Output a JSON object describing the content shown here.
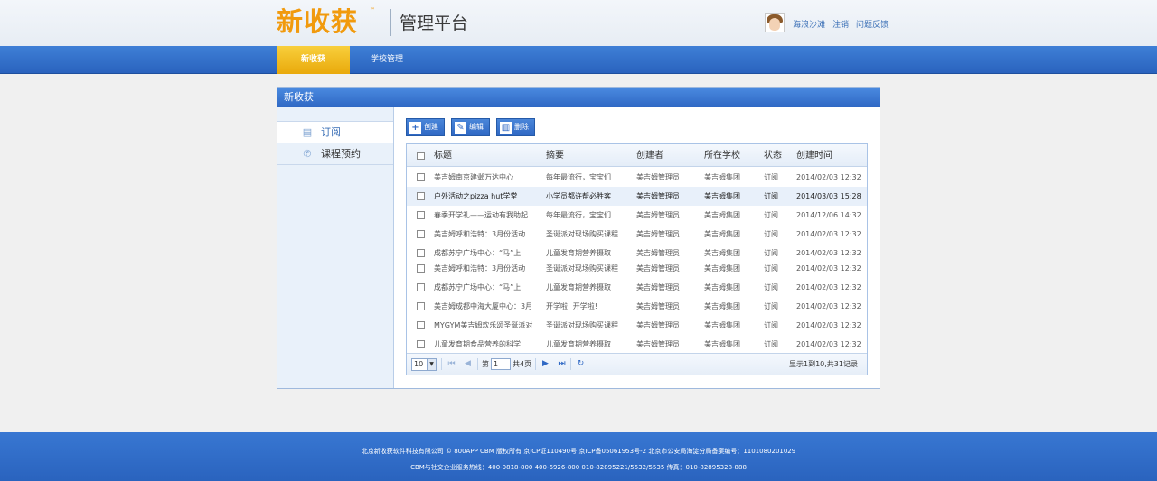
{
  "header": {
    "logo": "新收获",
    "logo_tm": "™",
    "platform_title": "管理平台",
    "user_links": [
      "海浪沙滩",
      "注销",
      "问题反馈"
    ]
  },
  "nav": {
    "items": [
      {
        "label": "新收获",
        "active": true
      },
      {
        "label": "学校管理",
        "active": false
      }
    ]
  },
  "panel": {
    "title": "新收获",
    "sidebar": [
      {
        "label": "订阅",
        "icon": "document-icon",
        "active": true
      },
      {
        "label": "课程预约",
        "icon": "phone-calendar-icon",
        "active": false
      }
    ],
    "toolbar": [
      {
        "label": "创建",
        "icon": "plus-icon"
      },
      {
        "label": "编辑",
        "icon": "edit-icon"
      },
      {
        "label": "删除",
        "icon": "trash-icon"
      }
    ]
  },
  "table": {
    "columns": [
      "标题",
      "摘要",
      "创建者",
      "所在学校",
      "状态",
      "创建时间"
    ],
    "rows": [
      {
        "title": "美吉姆南京建邺万达中心",
        "summary": "每年最流行，宝宝们",
        "creator": "美吉姆管理员",
        "school": "美吉姆集团",
        "status": "订阅",
        "time": "2014/02/03 12:32"
      },
      {
        "title": "户外活动之pizza hut学堂",
        "summary": "小学员都许帮必胜客",
        "creator": "美吉姆管理员",
        "school": "美吉姆集团",
        "status": "订阅",
        "time": "2014/03/03 15:28"
      },
      {
        "title": "春季开学礼——运动有我助起",
        "summary": "每年最流行，宝宝们",
        "creator": "美吉姆管理员",
        "school": "美吉姆集团",
        "status": "订阅",
        "time": "2014/12/06 14:32"
      },
      {
        "title": "美吉姆呼和浩特：3月份活动",
        "summary": "圣诞派对现场购买课程",
        "creator": "美吉姆管理员",
        "school": "美吉姆集团",
        "status": "订阅",
        "time": "2014/02/03 12:32"
      },
      {
        "title": "成都苏宁广场中心：“马”上",
        "summary": "儿童发育期营养摄取",
        "creator": "美吉姆管理员",
        "school": "美吉姆集团",
        "status": "订阅",
        "time": "2014/02/03 12:32"
      },
      {
        "title": "美吉姆呼和浩特：3月份活动",
        "summary": "圣诞派对现场购买课程",
        "creator": "美吉姆管理员",
        "school": "美吉姆集团",
        "status": "订阅",
        "time": "2014/02/03 12:32"
      },
      {
        "title": "成都苏宁广场中心：“马”上",
        "summary": "儿童发育期营养摄取",
        "creator": "美吉姆管理员",
        "school": "美吉姆集团",
        "status": "订阅",
        "time": "2014/02/03 12:32"
      },
      {
        "title": "美吉姆成都中海大厦中心：3月",
        "summary": "开学啦! 开学啦!",
        "creator": "美吉姆管理员",
        "school": "美吉姆集团",
        "status": "订阅",
        "time": "2014/02/03 12:32"
      },
      {
        "title": "MYGYM美吉姆欢乐颂圣诞派对",
        "summary": "圣诞派对现场购买课程",
        "creator": "美吉姆管理员",
        "school": "美吉姆集团",
        "status": "订阅",
        "time": "2014/02/03 12:32"
      },
      {
        "title": "儿童发育期食品营养的科学",
        "summary": "儿童发育期营养摄取",
        "creator": "美吉姆管理员",
        "school": "美吉姆集团",
        "status": "订阅",
        "time": "2014/02/03 12:32"
      }
    ]
  },
  "pager": {
    "page_size": "10",
    "page_prefix": "第",
    "current_page": "1",
    "page_suffix": "共4页",
    "info": "显示1到10,共31记录"
  },
  "footer": {
    "line1": "北京新收获软件科技有限公司 © 800APP CBM 版权所有 京ICP证110490号 京ICP备05061953号-2 北京市公安局海淀分局备案编号：1101080201029",
    "line2": "CBM与社交企业服务热线：400-0818-800 400-6926-800 010-82895221/5532/5535 传真：010-82895328-888"
  },
  "colors": {
    "brand_orange": "#f19a0d",
    "nav_blue": "#2f68c4",
    "nav_active": "#f1b51e",
    "link_blue": "#3a6fb6"
  }
}
